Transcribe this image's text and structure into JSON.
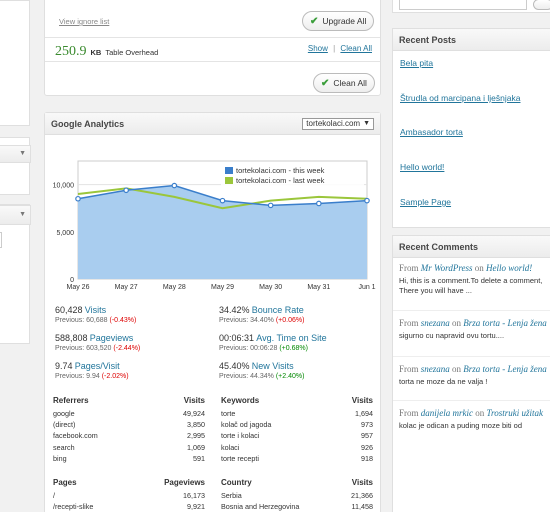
{
  "top": {
    "ignore_link": "View ignore list",
    "upgrade_button": "Upgrade All",
    "overhead_value": "250.9",
    "overhead_unit": "KB",
    "overhead_label": "Table Overhead",
    "show_link": "Show",
    "separator": "|",
    "clean_all_link": "Clean All",
    "clean_all_button": "Clean All"
  },
  "analytics": {
    "title": "Google Analytics",
    "site_select": "tortekolaci.com",
    "legend": [
      "tortekolaci.com - this week",
      "tortekolaci.com - last week"
    ],
    "metrics": [
      {
        "value": "60,428",
        "label": "Visits",
        "prev_label": "Previous:",
        "prev": "60,688",
        "delta": "(-0.43%)",
        "trend": "neg"
      },
      {
        "value": "34.42%",
        "label": "Bounce Rate",
        "prev_label": "Previous:",
        "prev": "34.40%",
        "delta": "(+0.06%)",
        "trend": "neg"
      },
      {
        "value": "588,808",
        "label": "Pageviews",
        "prev_label": "Previous:",
        "prev": "603,520",
        "delta": "(-2.44%)",
        "trend": "neg"
      },
      {
        "value": "00:06:31",
        "label": "Avg. Time on Site",
        "prev_label": "Previous:",
        "prev": "00:06:28",
        "delta": "(+0.68%)",
        "trend": "pos"
      },
      {
        "value": "9.74",
        "label": "Pages/Visit",
        "prev_label": "Previous:",
        "prev": "9.94",
        "delta": "(-2.02%)",
        "trend": "neg"
      },
      {
        "value": "45.40%",
        "label": "New Visits",
        "prev_label": "Previous:",
        "prev": "44.34%",
        "delta": "(+2.40%)",
        "trend": "pos"
      }
    ],
    "referrers": {
      "head": "Referrers",
      "head2": "Visits",
      "rows": [
        [
          "google",
          "49,924"
        ],
        [
          "(direct)",
          "3,850"
        ],
        [
          "facebook.com",
          "2,995"
        ],
        [
          "search",
          "1,069"
        ],
        [
          "bing",
          "591"
        ]
      ]
    },
    "keywords": {
      "head": "Keywords",
      "head2": "Visits",
      "rows": [
        [
          "torte",
          "1,694"
        ],
        [
          "kolač od jagoda",
          "973"
        ],
        [
          "torte i kolaci",
          "957"
        ],
        [
          "kolaci",
          "926"
        ],
        [
          "torte recepti",
          "918"
        ]
      ]
    },
    "pages": {
      "head": "Pages",
      "head2": "Pageviews",
      "rows": [
        [
          "/",
          "16,173"
        ],
        [
          "/recepti-slike",
          "9,921"
        ]
      ]
    },
    "countries": {
      "head": "Country",
      "head2": "Visits",
      "rows": [
        [
          "Serbia",
          "21,366"
        ],
        [
          "Bosnia and Herzegovina",
          "11,458"
        ]
      ]
    }
  },
  "chart_data": {
    "type": "area",
    "categories": [
      "May 26",
      "May 27",
      "May 28",
      "May 29",
      "May 30",
      "May 31",
      "Jun 1"
    ],
    "series": [
      {
        "name": "tortekolaci.com - this week",
        "values": [
          8500,
          9400,
          9900,
          8300,
          7800,
          8000,
          8300
        ]
      },
      {
        "name": "tortekolaci.com - last week",
        "values": [
          9000,
          9600,
          8700,
          7500,
          8300,
          8700,
          8500
        ]
      }
    ],
    "yticks": [
      "10,000",
      "5,000",
      "0"
    ],
    "ylim": [
      0,
      12500
    ],
    "colors": {
      "this_week": "#3a7ecb",
      "this_week_fill": "#a9cdef",
      "last_week": "#9bc63b"
    }
  },
  "recent_posts": {
    "title": "Recent Posts",
    "items": [
      "Bela pita",
      "Štrudla od marcipana i lješnjaka",
      "Ambasador torta",
      "Hello world!",
      "Sample Page"
    ]
  },
  "recent_comments": {
    "title": "Recent Comments",
    "items": [
      {
        "from": "From",
        "author": "Mr WordPress",
        "on": "on",
        "post": "Hello world!",
        "body1": "Hi, this is a comment.To delete a comment,",
        "body2": "There you will have ..."
      },
      {
        "from": "From",
        "author": "snezana",
        "on": "on",
        "post": "Brza torta - Lenja žena",
        "body1": "sigurno cu napravid ovu tortu....",
        "body2": ""
      },
      {
        "from": "From",
        "author": "snezana",
        "on": "on",
        "post": "Brza torta - Lenja žena",
        "body1": "torta ne moze da ne valja !",
        "body2": ""
      },
      {
        "from": "From",
        "author": "danijela mrkic",
        "on": "on",
        "post": "Trostruki užitak",
        "body1": "kolac je odican a puding moze biti od",
        "body2": ""
      }
    ]
  }
}
